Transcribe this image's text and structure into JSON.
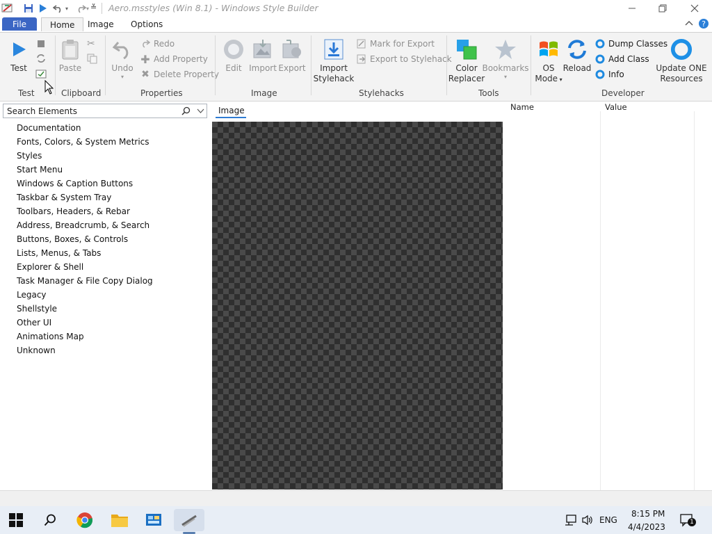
{
  "window": {
    "title": "Aero.msstyles (Win 8.1) - Windows Style Builder"
  },
  "ribbon_tabs": [
    "File",
    "Home",
    "Image",
    "Options"
  ],
  "groups": {
    "test": {
      "label": "Test",
      "test_button": "Test"
    },
    "clipboard": {
      "label": "Clipboard",
      "paste": "Paste"
    },
    "properties": {
      "label": "Properties",
      "undo": "Undo",
      "redo": "Redo",
      "add_property": "Add Property",
      "delete_property": "Delete Property"
    },
    "image": {
      "label": "Image",
      "edit": "Edit",
      "import": "Import",
      "export": "Export"
    },
    "stylehacks": {
      "label": "Stylehacks",
      "import_line1": "Import",
      "import_line2": "Stylehack",
      "mark_for_export": "Mark for Export",
      "export_to_stylehack": "Export to Stylehack"
    },
    "tools": {
      "label": "Tools",
      "color_line1": "Color",
      "color_line2": "Replacer",
      "bookmarks": "Bookmarks"
    },
    "developer": {
      "label": "Developer",
      "os_line1": "OS",
      "os_line2": "Mode",
      "reload": "Reload",
      "dump_classes": "Dump Classes",
      "add_class": "Add Class",
      "info": "Info",
      "update_line1": "Update ONE",
      "update_line2": "Resources"
    }
  },
  "search": {
    "placeholder": "Search Elements"
  },
  "tree": [
    "Documentation",
    "Fonts, Colors, & System Metrics",
    "Styles",
    "Start Menu",
    "Windows & Caption Buttons",
    "Taskbar & System Tray",
    "Toolbars, Headers, & Rebar",
    "Address, Breadcrumb, & Search",
    "Buttons, Boxes, & Controls",
    "Lists, Menus, & Tabs",
    "Explorer & Shell",
    "Task Manager & File Copy Dialog",
    "Legacy",
    "Shellstyle",
    "Other UI",
    "Animations Map",
    "Unknown"
  ],
  "image_pane": {
    "tab": "Image"
  },
  "properties_pane": {
    "name_header": "Name",
    "value_header": "Value"
  },
  "tray": {
    "language": "ENG",
    "time": "8:15 PM",
    "date": "4/4/2023",
    "notifications": "1"
  },
  "colors": {
    "accent": "#3b66c4",
    "ribbon_bg": "#f3f3f3",
    "taskbar_bg": "#e8eef6",
    "tab_underline": "#2f7bd3"
  }
}
